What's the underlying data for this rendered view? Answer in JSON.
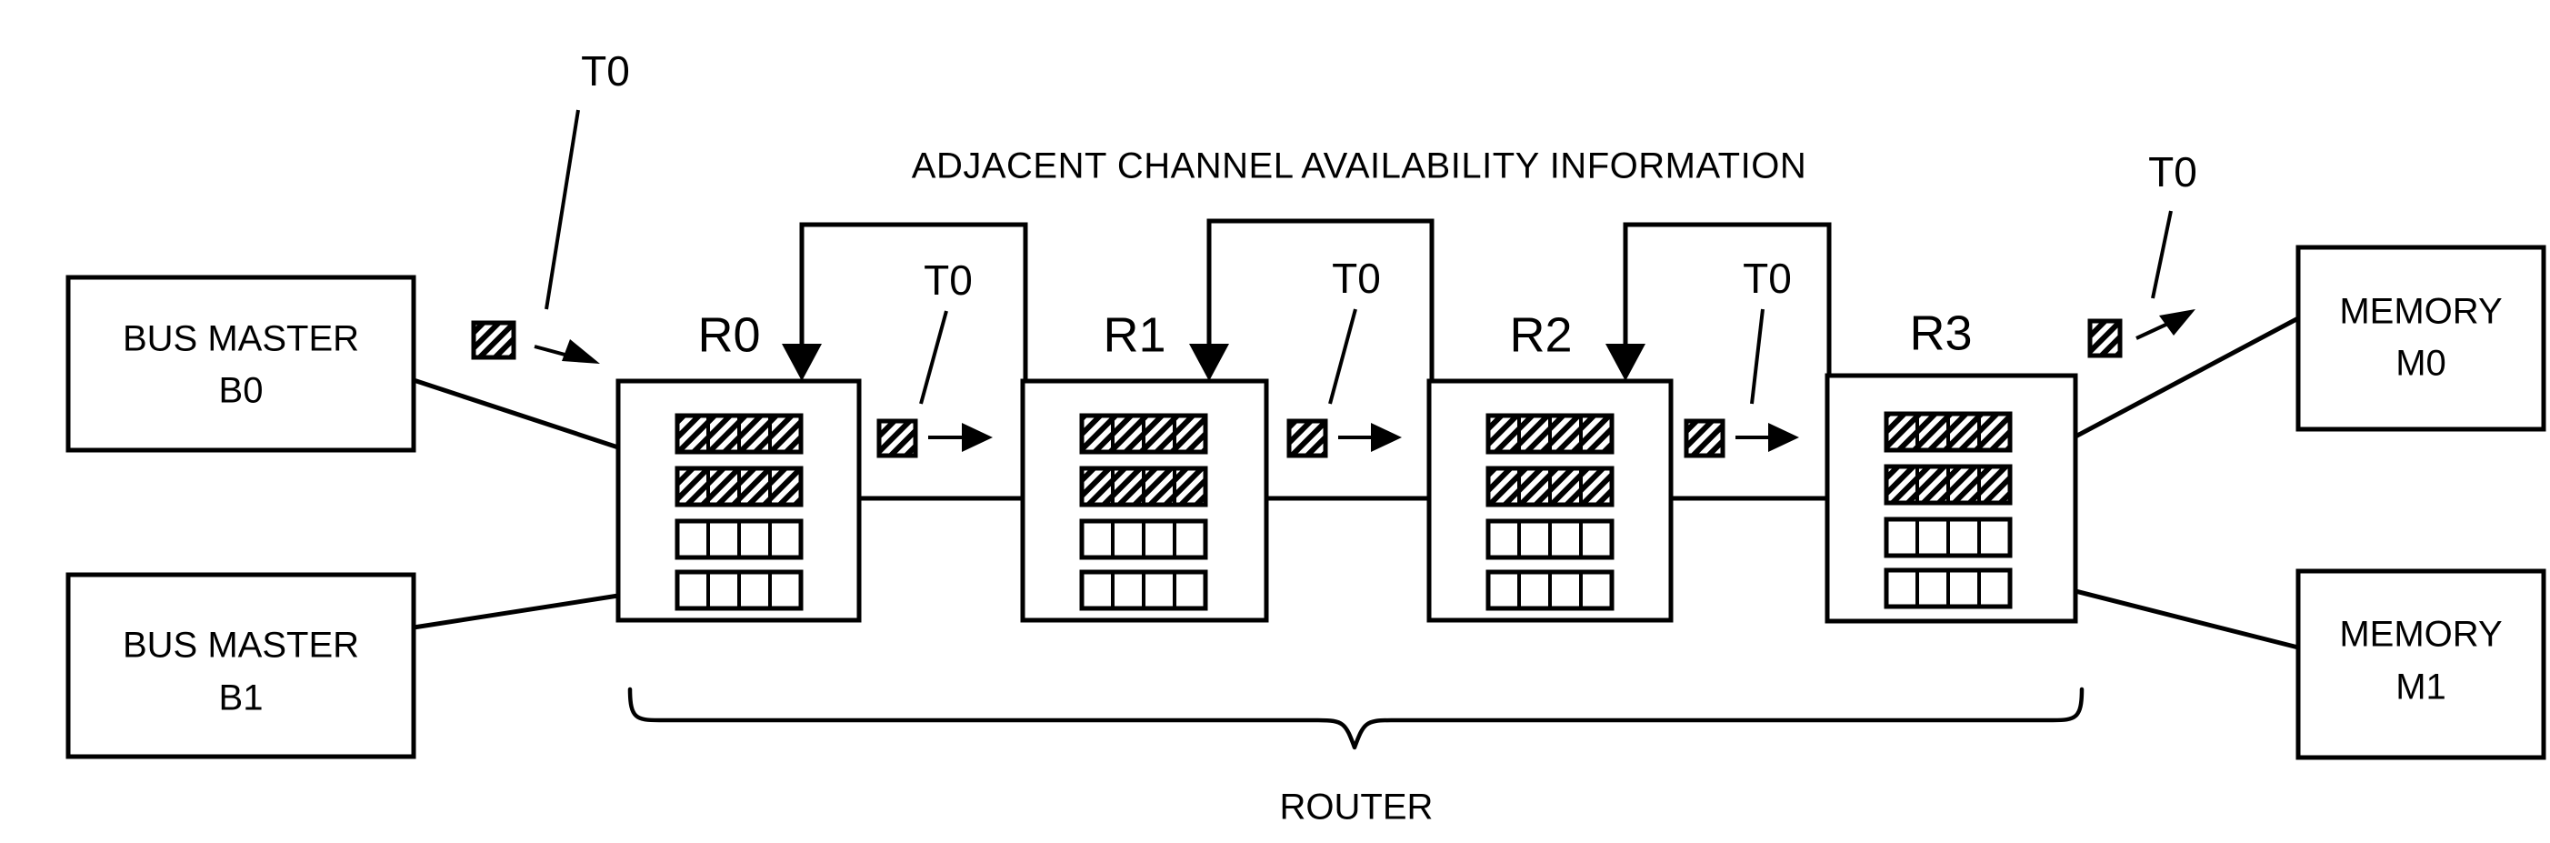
{
  "figure": {
    "title": "ADJACENT CHANNEL AVAILABILITY INFORMATION",
    "caption": "ROUTER"
  },
  "bus_masters": [
    {
      "line1": "BUS MASTER",
      "line2": "B0"
    },
    {
      "line1": "BUS MASTER",
      "line2": "B1"
    }
  ],
  "memories": [
    {
      "line1": "MEMORY",
      "line2": "M0"
    },
    {
      "line1": "MEMORY",
      "line2": "M1"
    }
  ],
  "routers": [
    {
      "label": "R0",
      "buffers": [
        {
          "occupied": true,
          "cells": 4
        },
        {
          "occupied": true,
          "cells": 4
        },
        {
          "occupied": false,
          "cells": 4
        },
        {
          "occupied": false,
          "cells": 4
        }
      ]
    },
    {
      "label": "R1",
      "buffers": [
        {
          "occupied": true,
          "cells": 4
        },
        {
          "occupied": true,
          "cells": 4
        },
        {
          "occupied": false,
          "cells": 4
        },
        {
          "occupied": false,
          "cells": 4
        }
      ]
    },
    {
      "label": "R2",
      "buffers": [
        {
          "occupied": true,
          "cells": 4
        },
        {
          "occupied": true,
          "cells": 4
        },
        {
          "occupied": false,
          "cells": 4
        },
        {
          "occupied": false,
          "cells": 4
        }
      ]
    },
    {
      "label": "R3",
      "buffers": [
        {
          "occupied": true,
          "cells": 4
        },
        {
          "occupied": true,
          "cells": 4
        },
        {
          "occupied": false,
          "cells": 4
        },
        {
          "occupied": false,
          "cells": 4
        }
      ]
    }
  ],
  "packet_tags": [
    {
      "id": "tag-ingress-b0",
      "label": "T0"
    },
    {
      "id": "tag-r0-r1",
      "label": "T0"
    },
    {
      "id": "tag-r1-r2",
      "label": "T0"
    },
    {
      "id": "tag-r2-r3",
      "label": "T0"
    },
    {
      "id": "tag-egress-m0",
      "label": "T0"
    }
  ],
  "colors": {
    "stroke": "#000000",
    "background": "#ffffff",
    "hatch": "#000000"
  }
}
